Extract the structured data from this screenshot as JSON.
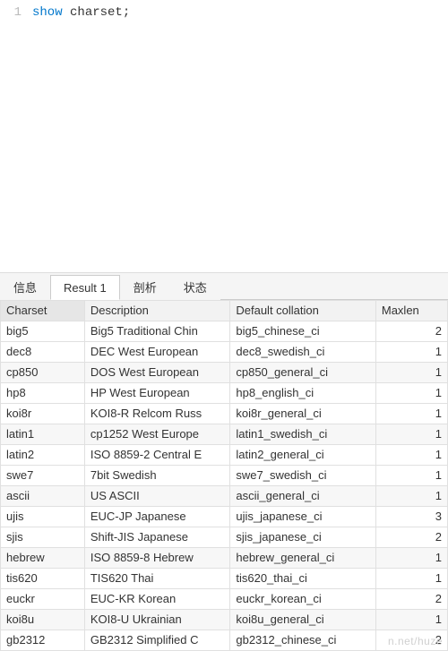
{
  "editor": {
    "line_number": "1",
    "keyword": "show",
    "rest": " charset;"
  },
  "tabs": {
    "items": [
      {
        "label": "信息",
        "active": false
      },
      {
        "label": "Result 1",
        "active": true
      },
      {
        "label": "剖析",
        "active": false
      },
      {
        "label": "状态",
        "active": false
      }
    ]
  },
  "table": {
    "headers": {
      "charset": "Charset",
      "description": "Description",
      "default_collation": "Default collation",
      "maxlen": "Maxlen"
    },
    "rows": [
      {
        "charset": "big5",
        "description": "Big5 Traditional Chin",
        "collation": "big5_chinese_ci",
        "maxlen": "2",
        "striped": false,
        "current": false
      },
      {
        "charset": "dec8",
        "description": "DEC West European",
        "collation": "dec8_swedish_ci",
        "maxlen": "1",
        "striped": false,
        "current": false
      },
      {
        "charset": "cp850",
        "description": "DOS West European",
        "collation": "cp850_general_ci",
        "maxlen": "1",
        "striped": true,
        "current": false
      },
      {
        "charset": "hp8",
        "description": "HP West European",
        "collation": "hp8_english_ci",
        "maxlen": "1",
        "striped": false,
        "current": false
      },
      {
        "charset": "koi8r",
        "description": "KOI8-R Relcom Russ",
        "collation": "koi8r_general_ci",
        "maxlen": "1",
        "striped": false,
        "current": false
      },
      {
        "charset": "latin1",
        "description": "cp1252 West Europe",
        "collation": "latin1_swedish_ci",
        "maxlen": "1",
        "striped": true,
        "current": true
      },
      {
        "charset": "latin2",
        "description": "ISO 8859-2 Central E",
        "collation": "latin2_general_ci",
        "maxlen": "1",
        "striped": false,
        "current": false
      },
      {
        "charset": "swe7",
        "description": "7bit Swedish",
        "collation": "swe7_swedish_ci",
        "maxlen": "1",
        "striped": false,
        "current": false
      },
      {
        "charset": "ascii",
        "description": "US ASCII",
        "collation": "ascii_general_ci",
        "maxlen": "1",
        "striped": true,
        "current": false
      },
      {
        "charset": "ujis",
        "description": "EUC-JP Japanese",
        "collation": "ujis_japanese_ci",
        "maxlen": "3",
        "striped": false,
        "current": false
      },
      {
        "charset": "sjis",
        "description": "Shift-JIS Japanese",
        "collation": "sjis_japanese_ci",
        "maxlen": "2",
        "striped": false,
        "current": false
      },
      {
        "charset": "hebrew",
        "description": "ISO 8859-8 Hebrew",
        "collation": "hebrew_general_ci",
        "maxlen": "1",
        "striped": true,
        "current": false
      },
      {
        "charset": "tis620",
        "description": "TIS620 Thai",
        "collation": "tis620_thai_ci",
        "maxlen": "1",
        "striped": false,
        "current": false
      },
      {
        "charset": "euckr",
        "description": "EUC-KR Korean",
        "collation": "euckr_korean_ci",
        "maxlen": "2",
        "striped": false,
        "current": false
      },
      {
        "charset": "koi8u",
        "description": "KOI8-U Ukrainian",
        "collation": "koi8u_general_ci",
        "maxlen": "1",
        "striped": true,
        "current": false
      },
      {
        "charset": "gb2312",
        "description": "GB2312 Simplified C",
        "collation": "gb2312_chinese_ci",
        "maxlen": "2",
        "striped": false,
        "current": false
      }
    ]
  },
  "watermark": "n.net/huze"
}
